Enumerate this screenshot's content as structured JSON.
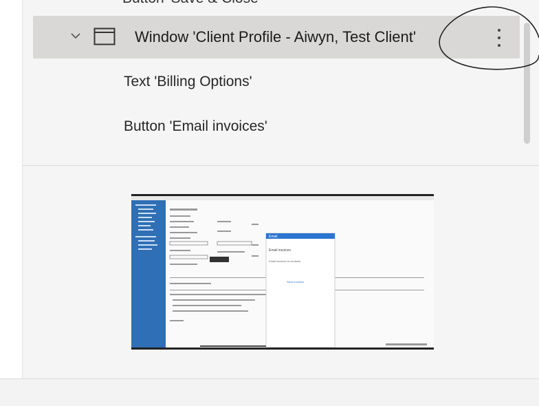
{
  "tree": {
    "partial_row": "Button 'Save & Close'",
    "window_row": {
      "label": "Window 'Client Profile - Aiwyn, Test Client'"
    },
    "rows": [
      {
        "label": "Text 'Billing Options'"
      },
      {
        "label": "Button 'Email invoices'"
      }
    ]
  },
  "preview": {
    "popup_title": "Email",
    "popup_heading": "Email invoices",
    "popup_text": "Email invoices to contacts",
    "popup_button": "Send invoices"
  },
  "icons": {
    "chevron": "chevron-down-icon",
    "window": "window-icon",
    "more": "more-vertical-icon"
  },
  "colors": {
    "selected_row_bg": "#d9d8d6",
    "panel_bg": "#f5f5f5",
    "preview_sidebar": "#2f6fb5",
    "preview_popup_header": "#2b74d0"
  }
}
